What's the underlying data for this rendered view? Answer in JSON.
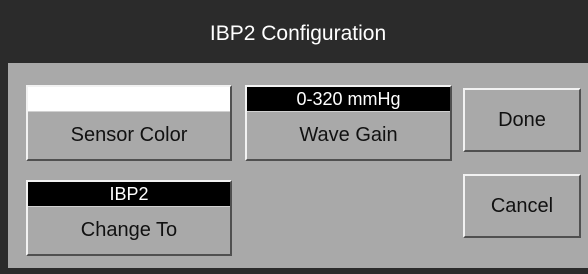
{
  "dialog": {
    "title": "IBP2 Configuration"
  },
  "controls": {
    "sensor_color": {
      "indicator_color": "#ffffff",
      "label": "Sensor Color"
    },
    "wave_gain": {
      "value": "0-320 mmHg",
      "label": "Wave Gain"
    },
    "change_to": {
      "value": "IBP2",
      "label": "Change To"
    }
  },
  "buttons": {
    "done": "Done",
    "cancel": "Cancel"
  },
  "colors": {
    "frame": "#2b2b2b",
    "panel": "#a9a9a9",
    "value_bar": "#000000"
  }
}
